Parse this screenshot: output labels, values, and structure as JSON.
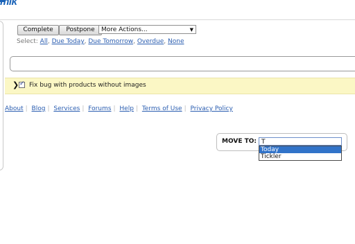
{
  "header": {
    "logo_text": "mlk"
  },
  "toolbar": {
    "complete_label": "Complete",
    "postpone_label": "Postpone",
    "more_actions_value": "More Actions..."
  },
  "select_row": {
    "label": "Select:",
    "options": [
      "All",
      "Due Today",
      "Due Tomorrow",
      "Overdue",
      "None"
    ]
  },
  "search": {
    "value": ""
  },
  "task": {
    "title": "Fix bug with products without images",
    "checked": true
  },
  "footer": {
    "links": [
      "About",
      "Blog",
      "Services",
      "Forums",
      "Help",
      "Terms of Use",
      "Privacy Policy"
    ]
  },
  "move_to": {
    "label": "MOVE TO:",
    "input_value": "T",
    "suggestions": [
      "Today",
      "Tickler"
    ],
    "highlighted_index": 0
  },
  "colors": {
    "link": "#2a5db0",
    "task_bg": "#fbf7c5",
    "highlight": "#3173c9"
  }
}
